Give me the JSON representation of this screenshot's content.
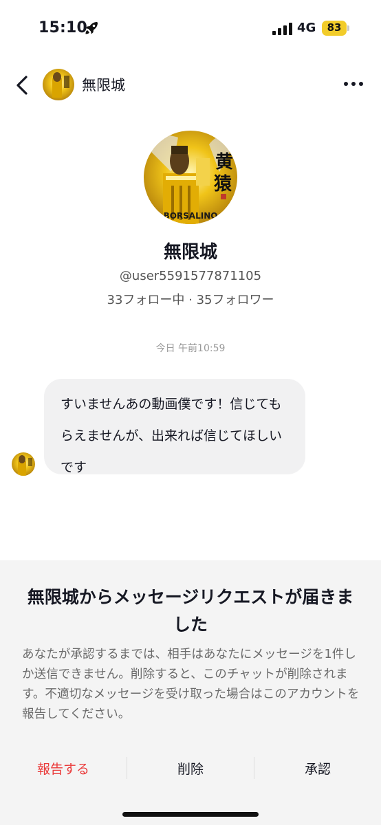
{
  "status_bar": {
    "time": "15:10",
    "network": "4G",
    "battery": "83",
    "icons": [
      "rocket-icon",
      "signal-icon",
      "battery-icon"
    ],
    "battery_color": "#f2cc2a"
  },
  "header": {
    "name": "無限城",
    "icons": [
      "chevron-left-icon",
      "more-icon"
    ]
  },
  "profile": {
    "name": "無限城",
    "handle": "@user5591577871105",
    "stats": "33フォロー中 · 35フォロワー",
    "avatar_caption": "BORSALINO"
  },
  "timestamp": "今日 午前10:59",
  "message": {
    "text": "すいませんあの動画僕です！信じてもらえませんが、出来れば信じてほしいです"
  },
  "request_sheet": {
    "title": "無限城からメッセージリクエストが届きました",
    "description": "あなたが承認するまでは、相手はあなたにメッセージを1件しか送信できません。削除すると、このチャットが削除されます。不適切なメッセージを受け取った場合はこのアカウントを報告してください。",
    "actions": {
      "report": "報告する",
      "delete": "削除",
      "accept": "承認"
    },
    "report_color": "#ea3a3a"
  }
}
